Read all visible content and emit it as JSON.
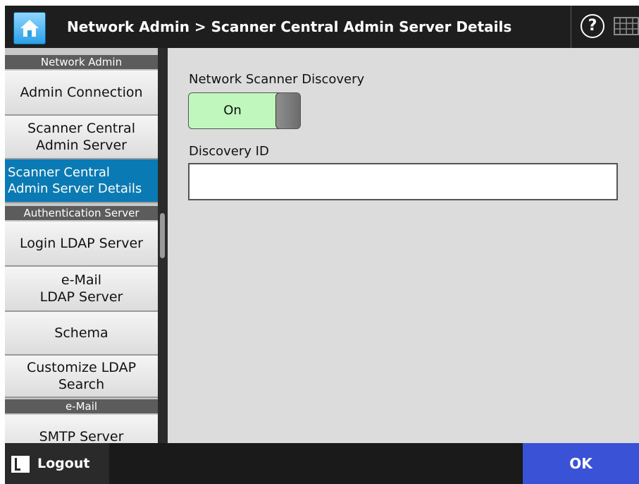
{
  "header": {
    "title": "Network Admin > Scanner Central Admin Server Details",
    "home_icon": "home-icon",
    "help_icon": "help-icon",
    "keyboard_icon": "keyboard-icon",
    "help_glyph": "?"
  },
  "sidebar": {
    "sections": [
      {
        "label": "Network Admin"
      },
      {
        "label": "Authentication Server"
      },
      {
        "label": "e-Mail"
      }
    ],
    "items": [
      {
        "label": "Admin Connection",
        "selected": false
      },
      {
        "label": "Scanner Central\nAdmin Server",
        "selected": false
      },
      {
        "label": "Scanner Central\nAdmin Server Details",
        "selected": true
      },
      {
        "label": "Login LDAP Server",
        "selected": false
      },
      {
        "label": "e-Mail\nLDAP Server",
        "selected": false
      },
      {
        "label": "Schema",
        "selected": false
      },
      {
        "label": "Customize LDAP\nSearch",
        "selected": false
      },
      {
        "label": "SMTP Server",
        "selected": false
      }
    ]
  },
  "main": {
    "network_scanner_discovery": {
      "label": "Network Scanner Discovery",
      "toggle_value": "On"
    },
    "discovery_id": {
      "label": "Discovery ID",
      "value": ""
    }
  },
  "footer": {
    "logout_label": "Logout",
    "logout_icon": "logout-icon",
    "ok_label": "OK"
  },
  "colors": {
    "header_bg": "#1e1e1e",
    "selected_item": "#0a7ab4",
    "toggle_on": "#bff7bd",
    "ok_button": "#3a52d6",
    "content_bg": "#dcdcdc"
  }
}
